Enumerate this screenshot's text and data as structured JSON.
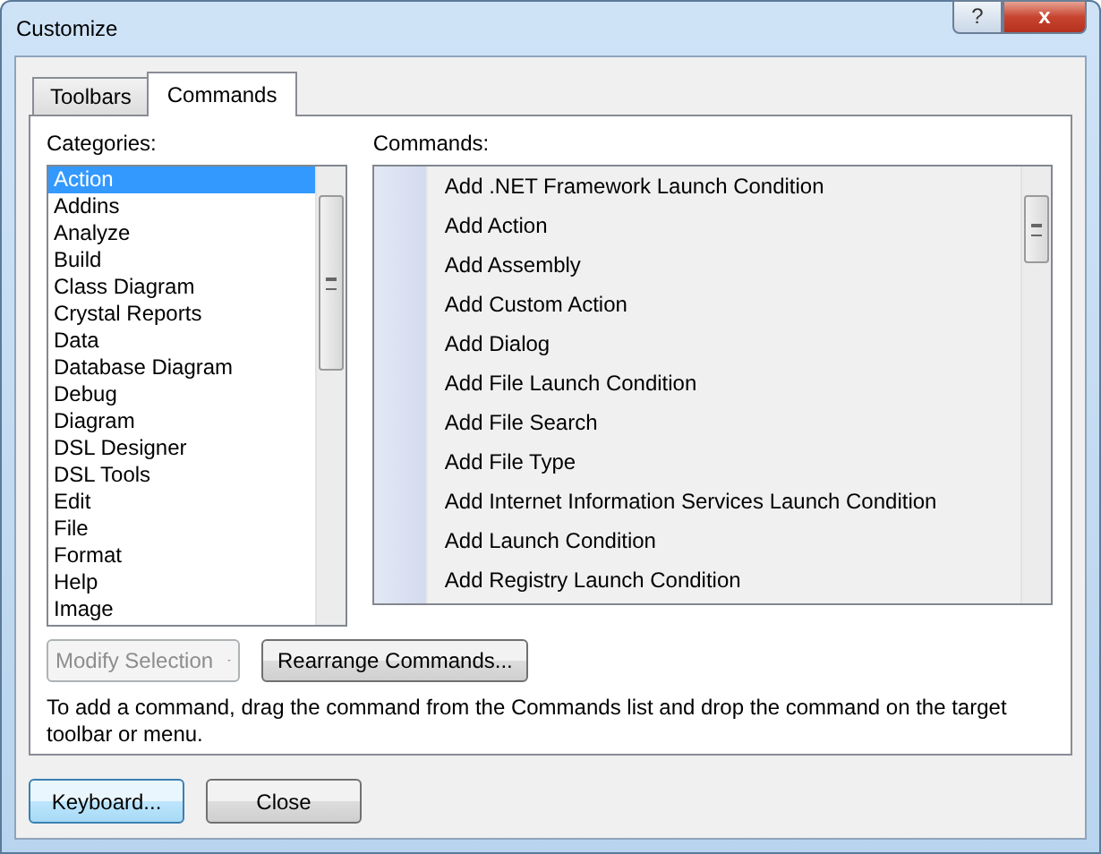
{
  "window": {
    "title": "Customize",
    "buttons": [
      {
        "kind": "help",
        "label": "?"
      },
      {
        "kind": "close",
        "label": "x"
      }
    ]
  },
  "tabs": [
    {
      "label": "Toolbars",
      "selected": false
    },
    {
      "label": "Commands",
      "selected": true
    }
  ],
  "categories": {
    "label": "Categories:",
    "items": [
      {
        "label": "Action",
        "selected": true
      },
      {
        "label": "Addins",
        "selected": false
      },
      {
        "label": "Analyze",
        "selected": false
      },
      {
        "label": "Build",
        "selected": false
      },
      {
        "label": "Class Diagram",
        "selected": false
      },
      {
        "label": "Crystal Reports",
        "selected": false
      },
      {
        "label": "Data",
        "selected": false
      },
      {
        "label": "Database Diagram",
        "selected": false
      },
      {
        "label": "Debug",
        "selected": false
      },
      {
        "label": "Diagram",
        "selected": false
      },
      {
        "label": "DSL Designer",
        "selected": false
      },
      {
        "label": "DSL Tools",
        "selected": false
      },
      {
        "label": "Edit",
        "selected": false
      },
      {
        "label": "File",
        "selected": false
      },
      {
        "label": "Format",
        "selected": false
      },
      {
        "label": "Help",
        "selected": false
      },
      {
        "label": "Image",
        "selected": false
      }
    ]
  },
  "commands": {
    "label": "Commands:",
    "items": [
      {
        "label": "Add .NET Framework Launch Condition",
        "selected": false
      },
      {
        "label": "Add Action",
        "selected": false
      },
      {
        "label": "Add Assembly",
        "selected": false
      },
      {
        "label": "Add Custom Action",
        "selected": false
      },
      {
        "label": "Add Dialog",
        "selected": false
      },
      {
        "label": "Add File Launch Condition",
        "selected": false
      },
      {
        "label": "Add File Search",
        "selected": false
      },
      {
        "label": "Add File Type",
        "selected": false
      },
      {
        "label": "Add Internet Information Services Launch Condition",
        "selected": false
      },
      {
        "label": "Add Launch Condition",
        "selected": false
      },
      {
        "label": "Add Registry Launch Condition",
        "selected": false
      }
    ]
  },
  "actions": [
    {
      "label": "Modify Selection",
      "kind": "dropdown",
      "disabled": true
    },
    {
      "label": "Rearrange Commands...",
      "kind": "button",
      "disabled": false
    }
  ],
  "hint": "To add a command, drag the command from the Commands list and drop the command on the target toolbar or menu.",
  "footer_buttons": [
    {
      "label": "Keyboard...",
      "focused": true
    },
    {
      "label": "Close",
      "focused": false
    }
  ]
}
